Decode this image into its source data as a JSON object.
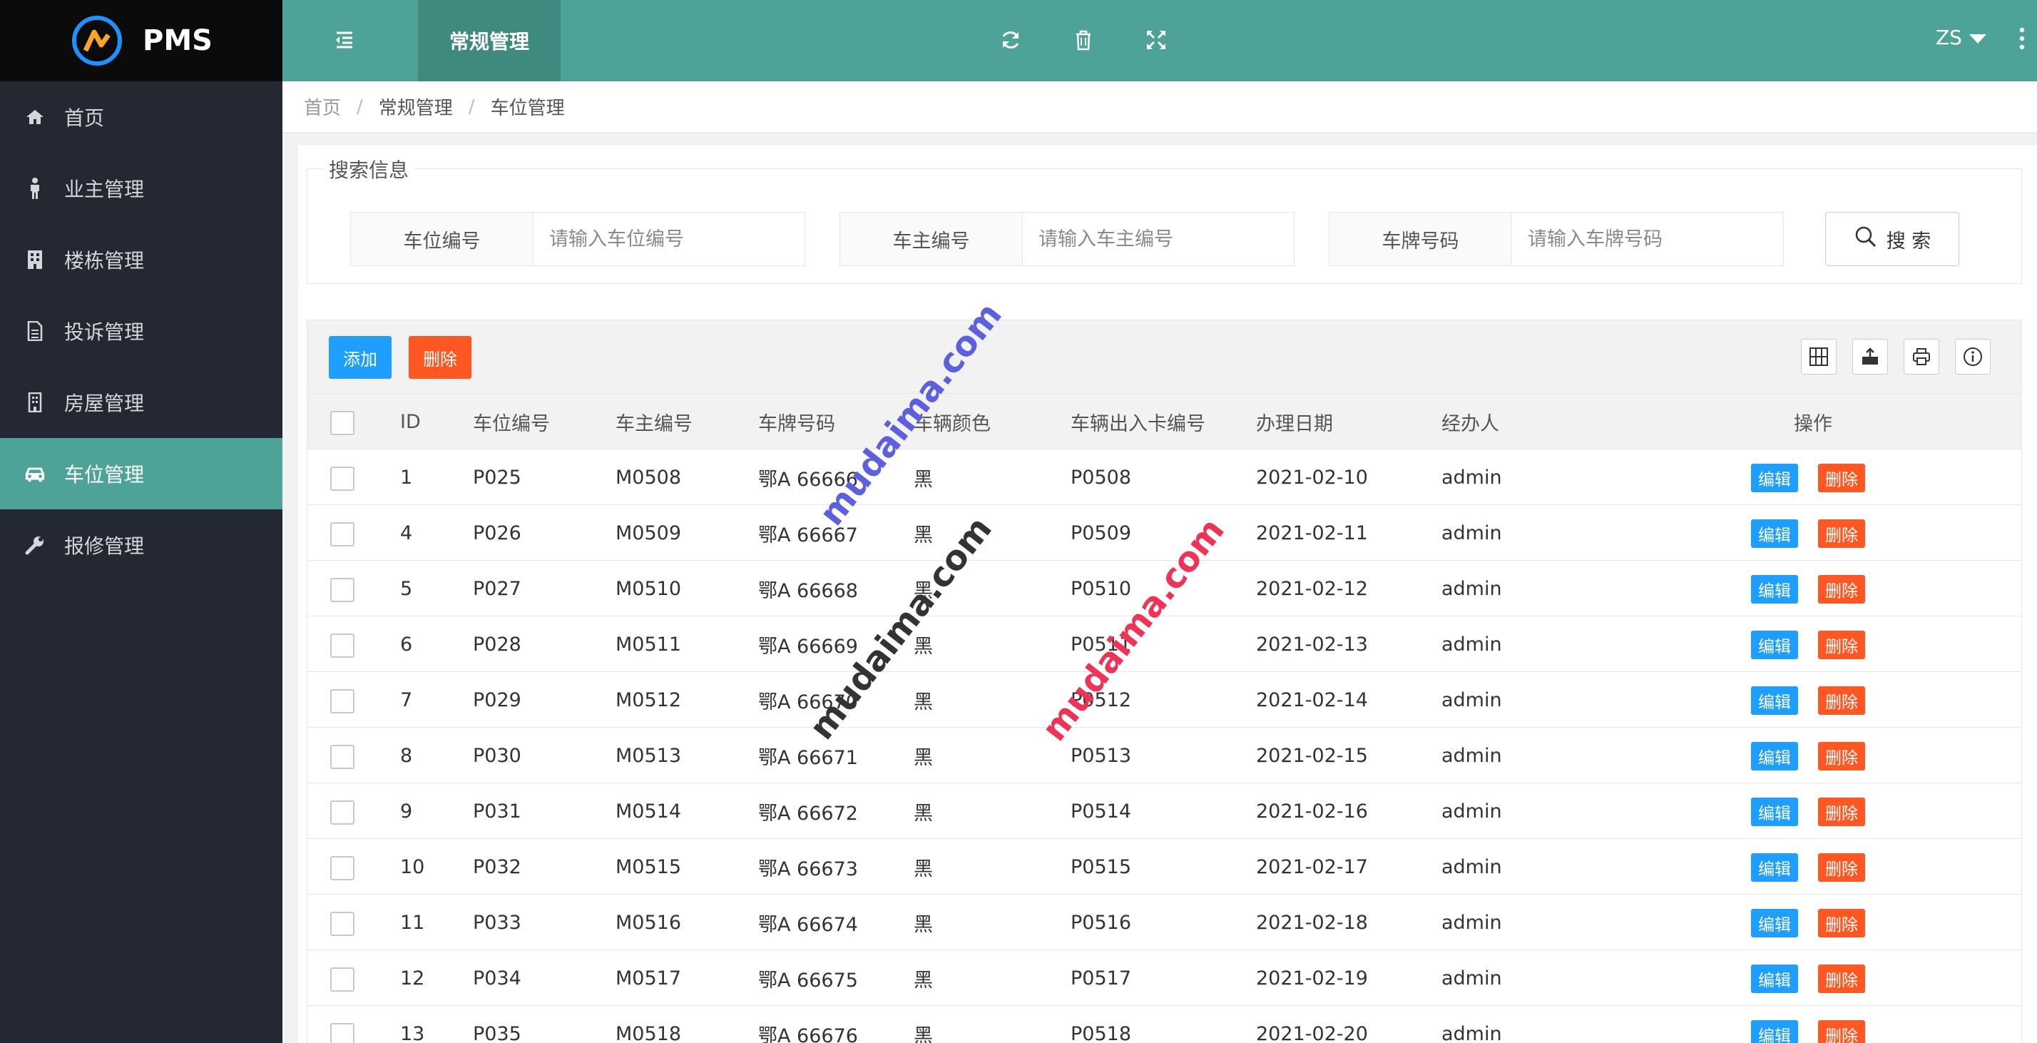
{
  "app": {
    "name": "PMS"
  },
  "sidebar": {
    "items": [
      {
        "label": "首页",
        "icon": "home-icon"
      },
      {
        "label": "业主管理",
        "icon": "person-icon"
      },
      {
        "label": "楼栋管理",
        "icon": "building-icon"
      },
      {
        "label": "投诉管理",
        "icon": "document-icon"
      },
      {
        "label": "房屋管理",
        "icon": "house-icon"
      },
      {
        "label": "车位管理",
        "icon": "car-icon",
        "active": true
      },
      {
        "label": "报修管理",
        "icon": "wrench-icon"
      }
    ]
  },
  "header": {
    "tab": "常规管理",
    "user": "ZS",
    "icons": [
      "fold-menu-icon",
      "refresh-icon",
      "trash-icon",
      "fullscreen-icon",
      "caret-down-icon",
      "more-icon"
    ]
  },
  "breadcrumb": [
    "首页",
    "常规管理",
    "车位管理"
  ],
  "search": {
    "legend": "搜索信息",
    "fields": [
      {
        "label": "车位编号",
        "placeholder": "请输入车位编号"
      },
      {
        "label": "车主编号",
        "placeholder": "请输入车主编号"
      },
      {
        "label": "车牌号码",
        "placeholder": "请输入车牌号码"
      }
    ],
    "button": "搜 索"
  },
  "toolbar": {
    "add": "添加",
    "delete": "删除",
    "tools": [
      "columns-icon",
      "export-icon",
      "print-icon",
      "info-icon"
    ]
  },
  "table": {
    "columns": [
      "ID",
      "车位编号",
      "车主编号",
      "车牌号码",
      "车辆颜色",
      "车辆出入卡编号",
      "办理日期",
      "经办人",
      "操作"
    ],
    "edit_label": "编辑",
    "delete_label": "删除",
    "rows": [
      [
        "1",
        "P025",
        "M0508",
        "鄂A 66666",
        "黑",
        "P0508",
        "2021-02-10",
        "admin"
      ],
      [
        "4",
        "P026",
        "M0509",
        "鄂A 66667",
        "黑",
        "P0509",
        "2021-02-11",
        "admin"
      ],
      [
        "5",
        "P027",
        "M0510",
        "鄂A 66668",
        "黑",
        "P0510",
        "2021-02-12",
        "admin"
      ],
      [
        "6",
        "P028",
        "M0511",
        "鄂A 66669",
        "黑",
        "P0511",
        "2021-02-13",
        "admin"
      ],
      [
        "7",
        "P029",
        "M0512",
        "鄂A 66670",
        "黑",
        "P0512",
        "2021-02-14",
        "admin"
      ],
      [
        "8",
        "P030",
        "M0513",
        "鄂A 66671",
        "黑",
        "P0513",
        "2021-02-15",
        "admin"
      ],
      [
        "9",
        "P031",
        "M0514",
        "鄂A 66672",
        "黑",
        "P0514",
        "2021-02-16",
        "admin"
      ],
      [
        "10",
        "P032",
        "M0515",
        "鄂A 66673",
        "黑",
        "P0515",
        "2021-02-17",
        "admin"
      ],
      [
        "11",
        "P033",
        "M0516",
        "鄂A 66674",
        "黑",
        "P0516",
        "2021-02-18",
        "admin"
      ],
      [
        "12",
        "P034",
        "M0517",
        "鄂A 66675",
        "黑",
        "P0517",
        "2021-02-19",
        "admin"
      ],
      [
        "13",
        "P035",
        "M0518",
        "鄂A 66676",
        "黑",
        "P0518",
        "2021-02-20",
        "admin"
      ]
    ]
  },
  "watermarks": [
    {
      "text": "mudaima.com",
      "color": "#5b5fe0"
    },
    {
      "text": "mudaima.com",
      "color": "#333333"
    },
    {
      "text": "mudaima.com",
      "color": "#ee3355"
    }
  ],
  "colors": {
    "primary": "#4ea398",
    "sidebar": "#242833",
    "blue": "#1e9fff",
    "orange": "#ff5722"
  }
}
